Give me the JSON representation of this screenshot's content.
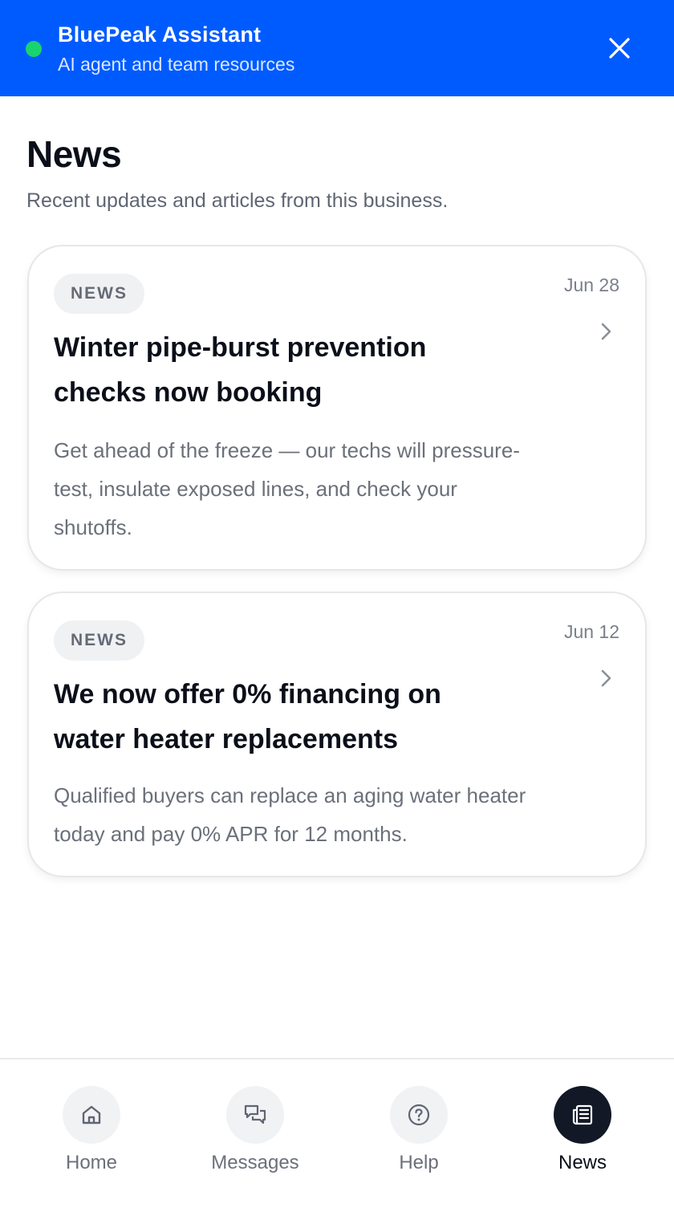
{
  "header": {
    "title": "BluePeak Assistant",
    "subtitle": "AI agent and team resources",
    "status_color": "#19d36f",
    "brand_color": "#005bff",
    "close_icon": "close-icon"
  },
  "page": {
    "title": "News",
    "subtitle": "Recent updates and articles from this business."
  },
  "articles": [
    {
      "tag": "NEWS",
      "date": "Jun 28",
      "title": "Winter pipe-burst prevention checks now booking",
      "body": "Get ahead of the freeze — our techs will pressure-test, insulate exposed lines, and check your shutoffs."
    },
    {
      "tag": "NEWS",
      "date": "Jun 12",
      "title": "We now offer 0% financing on water heater replacements",
      "body": "Qualified buyers can replace an aging water heater today and pay 0% APR for 12 months."
    }
  ],
  "nav": {
    "items": [
      {
        "label": "Home",
        "icon": "home-icon",
        "active": false
      },
      {
        "label": "Messages",
        "icon": "messages-icon",
        "active": false
      },
      {
        "label": "Help",
        "icon": "help-icon",
        "active": false
      },
      {
        "label": "News",
        "icon": "news-icon",
        "active": true
      }
    ]
  }
}
